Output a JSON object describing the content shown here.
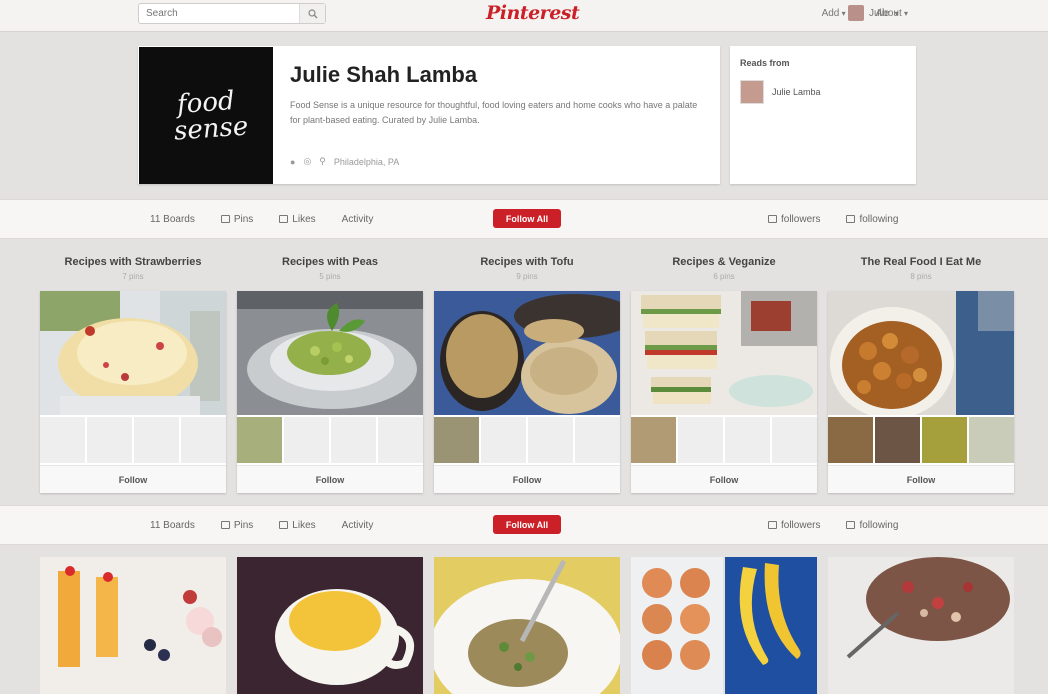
{
  "topbar": {
    "search_placeholder": "Search",
    "logo": "Pinterest",
    "nav": [
      "Add",
      "About"
    ],
    "user": "Julie"
  },
  "profile": {
    "name": "Julie Shah Lamba",
    "logo_line1": "food",
    "logo_line2": "sense",
    "bio": "Food Sense is a unique resource for thoughtful, food loving eaters and home cooks who have a palate for plant-based eating. Curated by Julie Lamba.",
    "location": "Philadelphia, PA"
  },
  "reads": {
    "title": "Reads from",
    "user": "Julie Lamba"
  },
  "tabbar": {
    "boards": "11 Boards",
    "pins": "Pins",
    "likes": "Likes",
    "activity": "Activity",
    "follow_all": "Follow All",
    "followers": "followers",
    "following": "following"
  },
  "boards": [
    {
      "title": "Recipes with Strawberries",
      "count": "7 pins",
      "follow": "Follow"
    },
    {
      "title": "Recipes with Peas",
      "count": "5 pins",
      "follow": "Follow"
    },
    {
      "title": "Recipes with Tofu",
      "count": "9 pins",
      "follow": "Follow"
    },
    {
      "title": "Recipes & Veganize",
      "count": "6 pins",
      "follow": "Follow"
    },
    {
      "title": "The Real Food I Eat Me",
      "count": "8 pins",
      "follow": "Follow"
    }
  ]
}
